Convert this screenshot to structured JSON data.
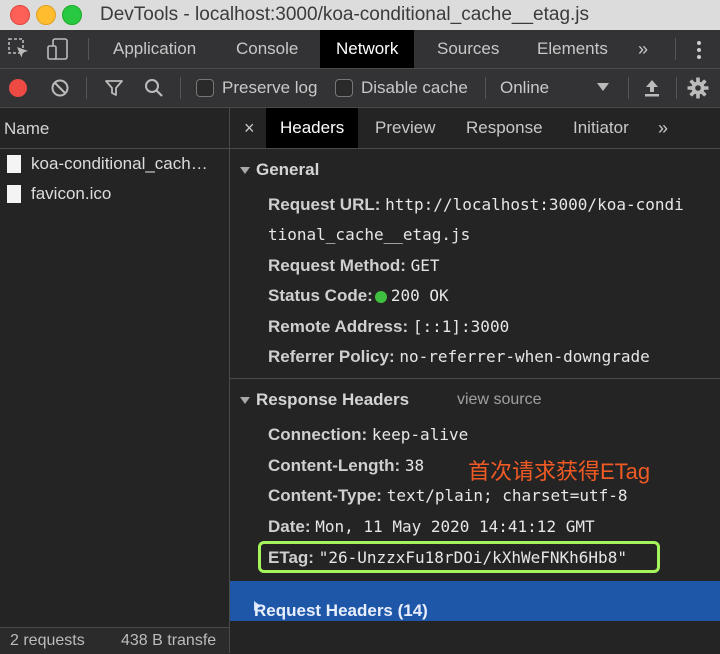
{
  "window": {
    "title": "DevTools - localhost:3000/koa-conditional_cache__etag.js"
  },
  "main_tabs": [
    {
      "label": "Application",
      "active": false
    },
    {
      "label": "Console",
      "active": false
    },
    {
      "label": "Network",
      "active": true
    },
    {
      "label": "Sources",
      "active": false
    },
    {
      "label": "Elements",
      "active": false
    }
  ],
  "toolbar": {
    "preserve_log": "Preserve log",
    "disable_cache": "Disable cache",
    "throttle": "Online"
  },
  "requests": {
    "header": "Name",
    "items": [
      "koa-conditional_cach…",
      "favicon.ico"
    ],
    "status_count": "2 requests",
    "status_size": "438 B transfe"
  },
  "detail_tabs": [
    {
      "label": "Headers",
      "active": true
    },
    {
      "label": "Preview",
      "active": false
    },
    {
      "label": "Response",
      "active": false
    },
    {
      "label": "Initiator",
      "active": false
    }
  ],
  "general": {
    "title": "General",
    "request_url_key": "Request URL:",
    "request_url_val1": "http://localhost:3000/koa-condi",
    "request_url_val2": "tional_cache__etag.js",
    "method_key": "Request Method:",
    "method_val": "GET",
    "status_key": "Status Code:",
    "status_val": "200 OK",
    "remote_key": "Remote Address:",
    "remote_val": "[::1]:3000",
    "referrer_key": "Referrer Policy:",
    "referrer_val": "no-referrer-when-downgrade"
  },
  "response_headers": {
    "title": "Response Headers",
    "view_source": "view source",
    "connection_key": "Connection:",
    "connection_val": "keep-alive",
    "length_key": "Content-Length:",
    "length_val": "38",
    "type_key": "Content-Type:",
    "type_val": "text/plain; charset=utf-8",
    "date_key": "Date:",
    "date_val": "Mon, 11 May 2020 14:41:12 GMT",
    "etag_key": "ETag:",
    "etag_val": "\"26-UnzzxFu18rDOi/kXhWeFNKh6Hb8\""
  },
  "annotation": "首次请求获得ETag",
  "request_headers": {
    "title": "Request Headers (14)"
  },
  "colors": {
    "accent_blue": "#1f57a8",
    "annotation": "#f05a24",
    "highlight": "#a4f55c",
    "status_ok": "#3fbf3f"
  }
}
